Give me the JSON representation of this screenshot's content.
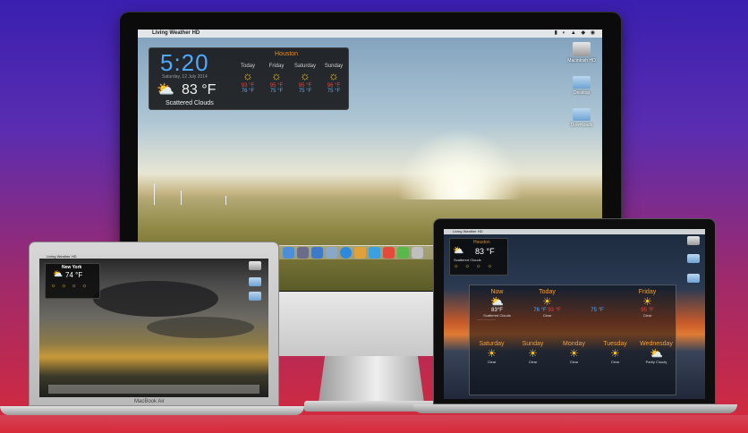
{
  "imac": {
    "menubar_app": "Living Weather HD",
    "widget": {
      "time": "5:20",
      "date": "Saturday, 12 July 2014",
      "city": "Houston",
      "current_temp": "83 °F",
      "condition": "Scattered Clouds",
      "days": [
        {
          "name": "Today",
          "hi": "93 °F",
          "lo": "76 °F"
        },
        {
          "name": "Friday",
          "hi": "95 °F",
          "lo": "75 °F"
        },
        {
          "name": "Saturday",
          "hi": "95 °F",
          "lo": "75 °F"
        },
        {
          "name": "Sunday",
          "hi": "96 °F",
          "lo": "75 °F"
        }
      ]
    },
    "desktop_items": [
      "Macintosh HD",
      "Desktop",
      "Downloads"
    ]
  },
  "macbook_air": {
    "label": "MacBook Air",
    "menubar_app": "Living Weather HD",
    "widget": {
      "city": "New York",
      "current_temp": "74 °F"
    }
  },
  "macbook_pro": {
    "menubar_app": "Living Weather HD",
    "widget": {
      "city": "Houston",
      "current_temp": "83 °F",
      "condition": "Scattered Clouds"
    },
    "forecast_top": [
      {
        "name": "Now",
        "temp": "83°F",
        "cond": "Scattered Clouds"
      },
      {
        "name": "Today",
        "temp": "76 °F",
        "temp2": "93 °F",
        "cond": "Clear"
      },
      {
        "name": "",
        "temp": "75 °F",
        "cond": ""
      },
      {
        "name": "Friday",
        "temp": "95 °F",
        "cond": "Clear"
      }
    ],
    "forecast_bottom": [
      {
        "name": "Saturday",
        "cond": "Clear"
      },
      {
        "name": "Sunday",
        "cond": "Clear"
      },
      {
        "name": "Monday",
        "cond": "Clear"
      },
      {
        "name": "Tuesday",
        "cond": "Clear"
      },
      {
        "name": "Wednesday",
        "cond": "Partly Cloudy"
      }
    ]
  },
  "colors": {
    "accent_blue": "#4ea8ff",
    "accent_orange": "#e38a2a",
    "hi_red": "#e8463a",
    "sun_yellow": "#e8c23c"
  }
}
